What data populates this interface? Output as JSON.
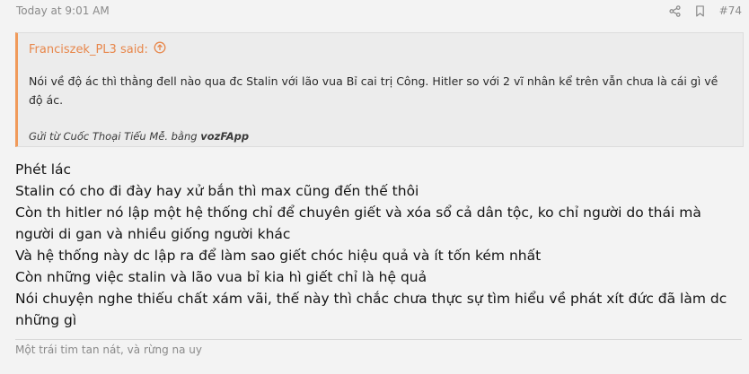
{
  "post": {
    "timestamp": "Today at 9:01 AM",
    "post_number": "#74",
    "icons": [
      "share-icon",
      "bookmark-icon"
    ],
    "accent_color": "#e8874b",
    "quote": {
      "author_said": "Franciszek_PL3 said:",
      "body": "Nói về độ ác thì thằng đell nào qua đc Stalin với lão vua Bỉ cai trị Công. Hitler so với 2 vĩ nhân kể trên vẫn chưa là cái gì về độ ác.",
      "sig_prefix": "Gửi từ Cuốc Thoại Tiểu Mễ. bằng",
      "sig_app": "vozFApp"
    },
    "message_lines": [
      "Phét lác",
      "Stalin có cho đi đày hay xử bắn thì max cũng đến thế thôi",
      "Còn th hitler nó lập một hệ thống chỉ để chuyên giết và xóa sổ cả dân tộc, ko chỉ người do thái mà người di gan và nhiều giống người khác",
      "Và hệ thống này dc lập ra để làm sao giết chóc hiệu quả và ít tốn kém nhất",
      "Còn những việc stalin và lão vua bỉ kia hì giết chỉ là hệ quả",
      "Nói chuyện nghe thiếu chất xám vãi, thế này thì chắc chưa thực sự tìm hiểu về phát xít đức đã làm dc những gì"
    ],
    "signature": "Một trái tim tan nát, và rừng na uy"
  }
}
